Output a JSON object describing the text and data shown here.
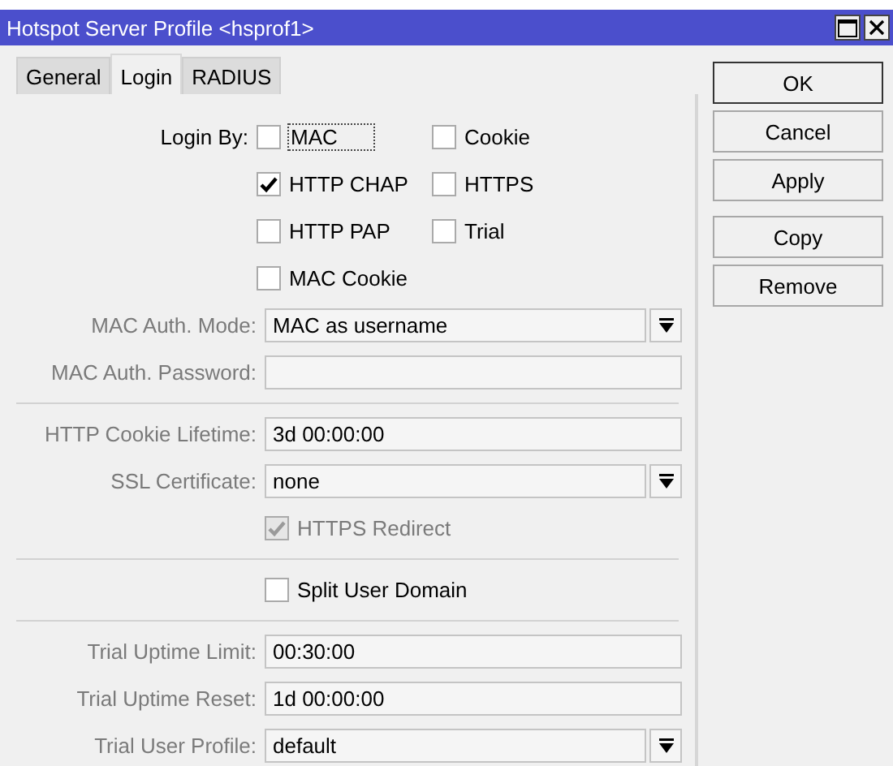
{
  "window": {
    "title": "Hotspot Server Profile <hsprof1>"
  },
  "tabs": [
    {
      "label": "General",
      "selected": false
    },
    {
      "label": "Login",
      "selected": true
    },
    {
      "label": "RADIUS",
      "selected": false
    }
  ],
  "login_by": {
    "label": "Login By:",
    "disabled": false,
    "options": [
      {
        "label": "MAC",
        "checked": false,
        "focused": true
      },
      {
        "label": "Cookie",
        "checked": false,
        "focused": false
      },
      {
        "label": "HTTP CHAP",
        "checked": true,
        "focused": false
      },
      {
        "label": "HTTPS",
        "checked": false,
        "focused": false
      },
      {
        "label": "HTTP PAP",
        "checked": false,
        "focused": false
      },
      {
        "label": "Trial",
        "checked": false,
        "focused": false
      },
      {
        "label": "MAC Cookie",
        "checked": false,
        "focused": false
      }
    ]
  },
  "rows": [
    {
      "kind": "dropdown",
      "label": "MAC Auth. Mode:",
      "value": "MAC as username",
      "disabled": true
    },
    {
      "kind": "text",
      "label": "MAC Auth. Password:",
      "disabled": true
    },
    {
      "kind": "divider"
    },
    {
      "kind": "text",
      "label": "HTTP Cookie Lifetime:",
      "value": "3d 00:00:00",
      "disabled": true
    },
    {
      "kind": "dropdown",
      "label": "SSL Certificate:",
      "value": "none",
      "disabled": true
    },
    {
      "kind": "checkbox",
      "text": "HTTPS Redirect",
      "checked": true,
      "disabled": true
    },
    {
      "kind": "divider"
    },
    {
      "kind": "checkbox",
      "text": "Split User Domain",
      "checked": false,
      "disabled": false
    },
    {
      "kind": "divider"
    },
    {
      "kind": "text",
      "label": "Trial Uptime Limit:",
      "value": "00:30:00",
      "disabled": true
    },
    {
      "kind": "text",
      "label": "Trial Uptime Reset:",
      "value": "1d 00:00:00",
      "disabled": true
    },
    {
      "kind": "dropdown",
      "label": "Trial User Profile:",
      "value": "default",
      "disabled": true
    }
  ],
  "button_groups": [
    [
      {
        "label": "OK",
        "default": true
      },
      {
        "label": "Cancel",
        "default": false
      },
      {
        "label": "Apply",
        "default": false
      }
    ],
    [
      {
        "label": "Copy",
        "default": false
      },
      {
        "label": "Remove",
        "default": false
      }
    ]
  ]
}
